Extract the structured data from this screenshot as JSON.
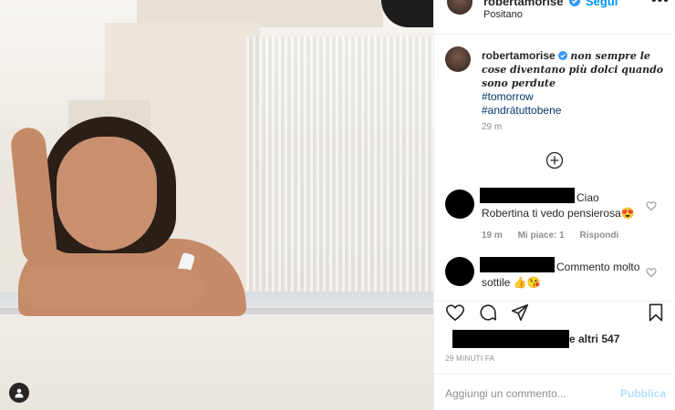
{
  "header": {
    "username": "robertamorise",
    "follow_label": "Segui",
    "more_label": "•••",
    "location": "Positano"
  },
  "caption": {
    "username": "robertamorise",
    "text": "non sempre le cose diventano più dolci quando sono perdute",
    "hashtags": [
      "#tomorrow",
      "#andràtuttobene"
    ],
    "time": "29 m"
  },
  "comments": [
    {
      "text": "Ciao Robertina ti vedo pensierosa😍",
      "time": "19 m",
      "likes": "Mi piace: 1",
      "reply": "Rispondi"
    },
    {
      "text": "Commento molto sottile 👍😘"
    }
  ],
  "likes_suffix": "e altri 547",
  "post_time": "29 MINUTI FA",
  "add_comment": {
    "placeholder": "Aggiungi un commento...",
    "publish_label": "Pubblica"
  },
  "colors": {
    "link": "#00376b",
    "follow": "#0095f6",
    "publish_disabled": "#b2dffc",
    "muted": "#8e8e8e"
  }
}
